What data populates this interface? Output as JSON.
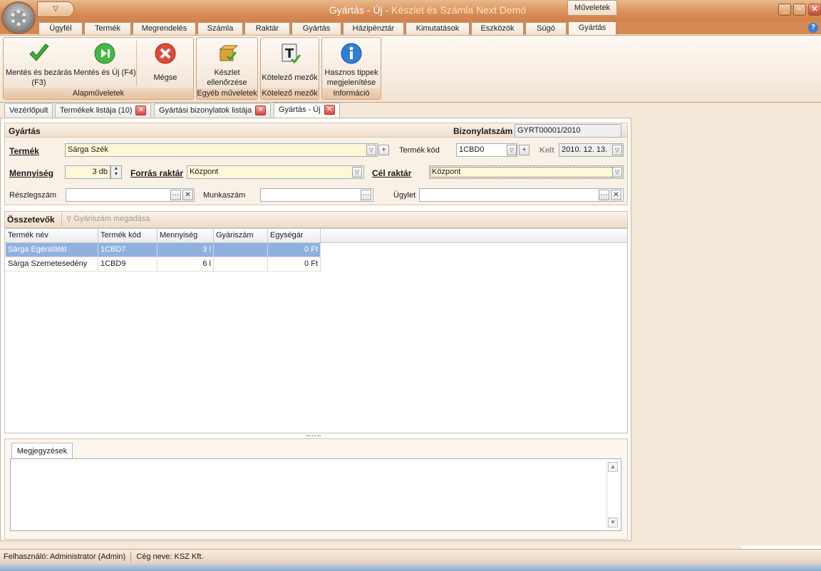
{
  "window": {
    "title": "Gyártás - Új",
    "title_suffix": " - Készlet és Számla Next Demó",
    "context_tab": "Műveletek",
    "qat_label": "▽",
    "minimize": "_",
    "restore": "▫",
    "close": "✕"
  },
  "ribbon_tabs": [
    "Ügyfél",
    "Termék",
    "Megrendelés",
    "Számla",
    "Raktár",
    "Gyártás",
    "Házipénztár",
    "Kimutatások",
    "Eszközök",
    "Súgó",
    "Gyártás"
  ],
  "help_label": "?",
  "ribbon": {
    "groups": [
      {
        "label": "Alapműveletek",
        "buttons": [
          "Mentés és bezárás (F3)",
          "Mentés és Új (F4)",
          "Mégse"
        ]
      },
      {
        "label": "Egyéb műveletek",
        "buttons": [
          "Készlet ellenőrzése"
        ]
      },
      {
        "label": "Kötelező mezők",
        "buttons": [
          "Kötelező mezők"
        ]
      },
      {
        "label": "Információ",
        "buttons": [
          "Hasznos tippek megjelenítése"
        ]
      }
    ]
  },
  "doc_tabs": [
    {
      "label": "Vezérlőpult",
      "closable": false
    },
    {
      "label": "Termékek listája (10)",
      "closable": true
    },
    {
      "label": "Gyártási bizonylatok listája",
      "closable": true
    },
    {
      "label": "Gyártás - Új",
      "closable": true
    }
  ],
  "close_glyph": "✕",
  "form": {
    "section_title": "Gyártás",
    "doc_number_label": "Bizonylatszám",
    "doc_number_value": "GYRT00001/2010",
    "product_label": "Termék",
    "product_value": "Sárga Szék",
    "product_code_label": "Termék kód",
    "product_code_value": "1CBD0",
    "date_label": "Kelt",
    "date_value": "2010. 12. 13.",
    "quantity_label": "Mennyiség",
    "quantity_value": "3 db",
    "source_wh_label": "Forrás raktár",
    "source_wh_value": "Központ",
    "target_wh_label": "Cél raktár",
    "target_wh_value": "Központ",
    "dept_label": "Részlegszám",
    "dept_value": "",
    "job_label": "Munkaszám",
    "job_value": "",
    "deal_label": "Ügylet",
    "deal_value": "",
    "ellipsis": "···",
    "clear": "✕",
    "plus": "+",
    "dropdown": "▽"
  },
  "components": {
    "title": "Összetevők",
    "serial_button": "Gyáriszám megadása",
    "columns": [
      "Termék név",
      "Termék kód",
      "Mennyiség",
      "Gyáriszám",
      "Egységár"
    ],
    "rows": [
      {
        "name": "Sárga Egéralátét",
        "code": "1CBD7",
        "qty": "3 l",
        "serial": "",
        "price": "0 Ft",
        "selected": true
      },
      {
        "name": "Sárga Szemetesedény",
        "code": "1CBD9",
        "qty": "6 l",
        "serial": "",
        "price": "0 Ft",
        "selected": false
      }
    ]
  },
  "notes": {
    "tab_label": "Megjegyzések",
    "value": ""
  },
  "statusbar": {
    "user": "Felhasználó: Administrator (Admin)",
    "company": "Cég neve: KSZ Kft."
  },
  "colors": {
    "title_bar": "#d88e55",
    "selected_row": "#8fb1e0",
    "required_field": "#fff8d8"
  }
}
